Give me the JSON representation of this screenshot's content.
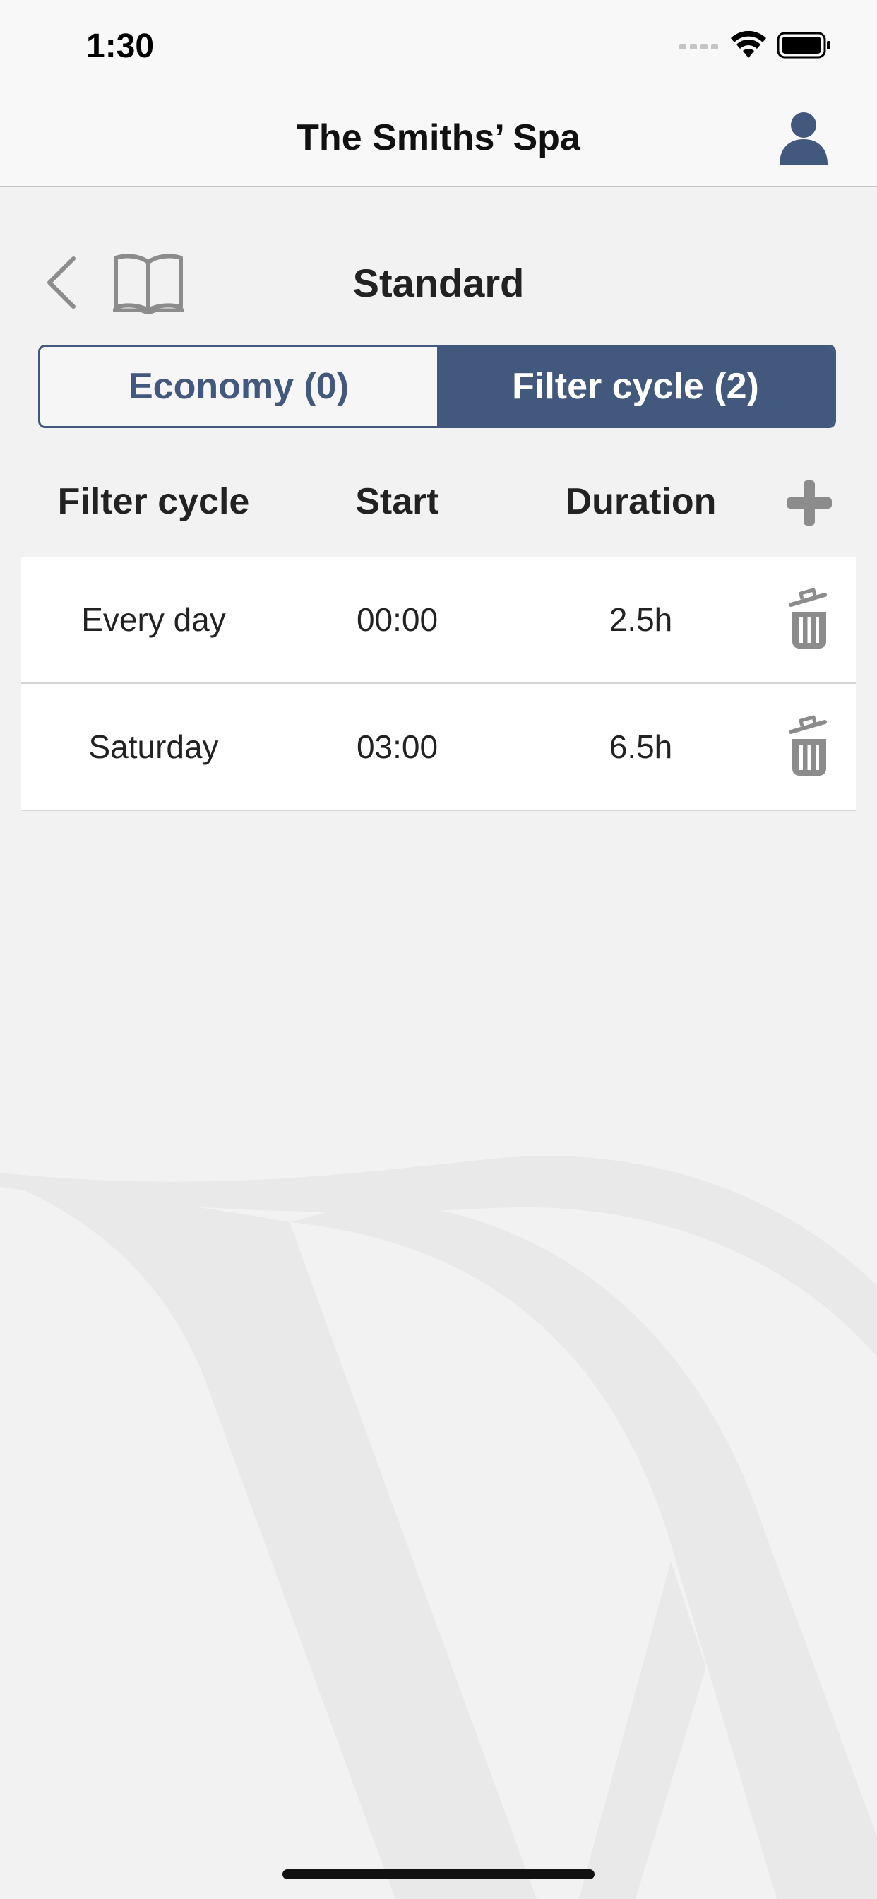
{
  "status_bar": {
    "time": "1:30"
  },
  "nav": {
    "title": "The Smiths’ Spa",
    "profile_icon": "person-icon"
  },
  "sub_header": {
    "title": "Standard",
    "back_icon": "chevron-left-icon",
    "manual_icon": "book-icon"
  },
  "tabs": [
    {
      "label": "Economy (0)",
      "selected": false
    },
    {
      "label": "Filter cycle (2)",
      "selected": true
    }
  ],
  "table": {
    "columns": [
      "Filter cycle",
      "Start",
      "Duration"
    ],
    "add_icon": "plus-icon",
    "rows": [
      {
        "day": "Every day",
        "start": "00:00",
        "duration": "2.5h"
      },
      {
        "day": "Saturday",
        "start": "03:00",
        "duration": "6.5h"
      }
    ],
    "delete_icon": "trash-icon"
  },
  "colors": {
    "accent": "#42587d",
    "background": "#f2f2f2",
    "icon_gray": "#8c8c8c"
  }
}
